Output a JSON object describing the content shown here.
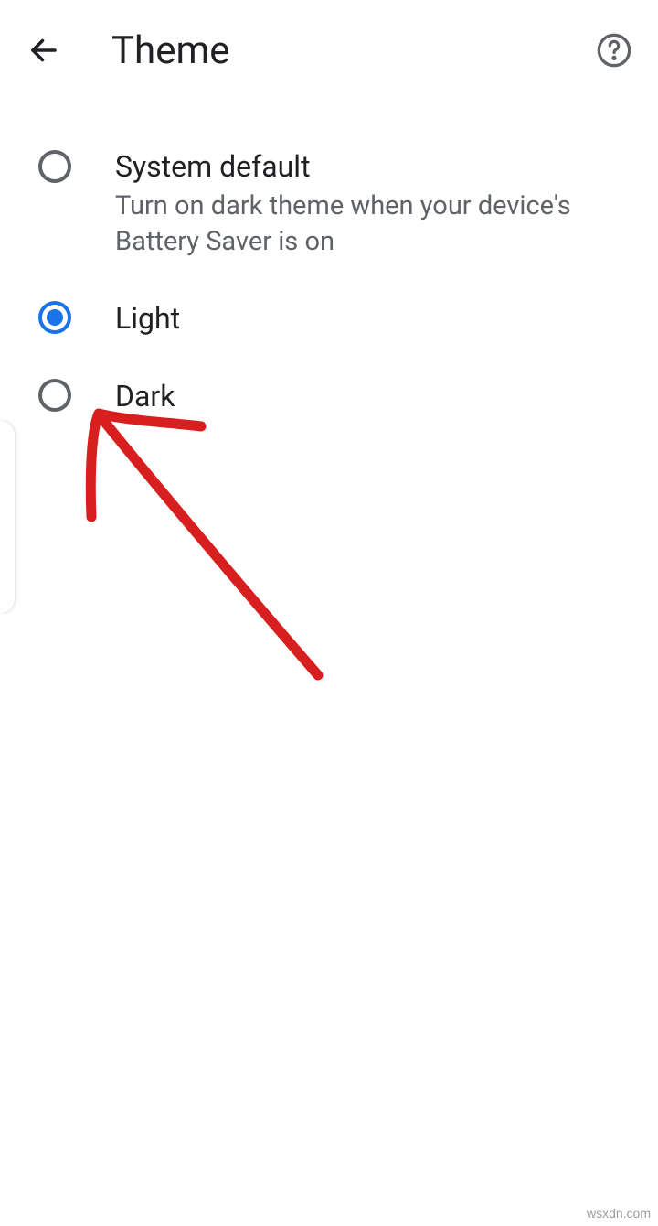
{
  "header": {
    "title": "Theme"
  },
  "options": [
    {
      "title": "System default",
      "description": "Turn on dark theme when your device's Battery Saver is on",
      "selected": false
    },
    {
      "title": "Light",
      "description": "",
      "selected": true
    },
    {
      "title": "Dark",
      "description": "",
      "selected": false
    }
  ],
  "watermark": "wsxdn.com",
  "colors": {
    "accent": "#1a73e8",
    "annotation": "#d81f1f",
    "text_primary": "#202124",
    "text_secondary": "#5f6368"
  }
}
